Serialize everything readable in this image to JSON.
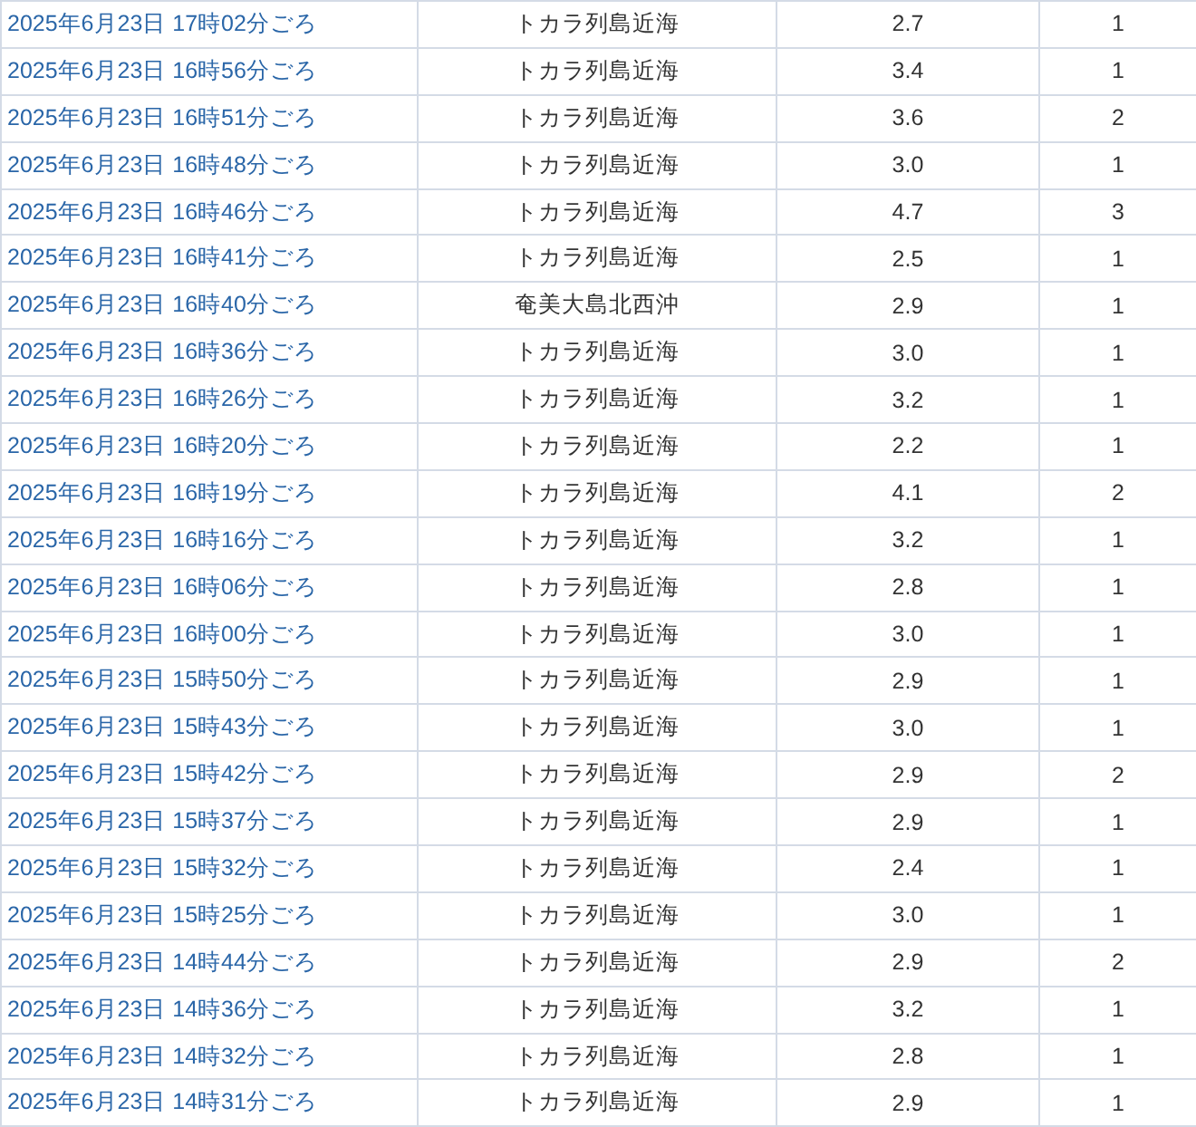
{
  "table": {
    "rows": [
      {
        "time": "2025年6月23日 17時02分ごろ",
        "region": "トカラ列島近海",
        "magnitude": "2.7",
        "intensity": "1"
      },
      {
        "time": "2025年6月23日 16時56分ごろ",
        "region": "トカラ列島近海",
        "magnitude": "3.4",
        "intensity": "1"
      },
      {
        "time": "2025年6月23日 16時51分ごろ",
        "region": "トカラ列島近海",
        "magnitude": "3.6",
        "intensity": "2"
      },
      {
        "time": "2025年6月23日 16時48分ごろ",
        "region": "トカラ列島近海",
        "magnitude": "3.0",
        "intensity": "1"
      },
      {
        "time": "2025年6月23日 16時46分ごろ",
        "region": "トカラ列島近海",
        "magnitude": "4.7",
        "intensity": "3"
      },
      {
        "time": "2025年6月23日 16時41分ごろ",
        "region": "トカラ列島近海",
        "magnitude": "2.5",
        "intensity": "1"
      },
      {
        "time": "2025年6月23日 16時40分ごろ",
        "region": "奄美大島北西沖",
        "magnitude": "2.9",
        "intensity": "1"
      },
      {
        "time": "2025年6月23日 16時36分ごろ",
        "region": "トカラ列島近海",
        "magnitude": "3.0",
        "intensity": "1"
      },
      {
        "time": "2025年6月23日 16時26分ごろ",
        "region": "トカラ列島近海",
        "magnitude": "3.2",
        "intensity": "1"
      },
      {
        "time": "2025年6月23日 16時20分ごろ",
        "region": "トカラ列島近海",
        "magnitude": "2.2",
        "intensity": "1"
      },
      {
        "time": "2025年6月23日 16時19分ごろ",
        "region": "トカラ列島近海",
        "magnitude": "4.1",
        "intensity": "2"
      },
      {
        "time": "2025年6月23日 16時16分ごろ",
        "region": "トカラ列島近海",
        "magnitude": "3.2",
        "intensity": "1"
      },
      {
        "time": "2025年6月23日 16時06分ごろ",
        "region": "トカラ列島近海",
        "magnitude": "2.8",
        "intensity": "1"
      },
      {
        "time": "2025年6月23日 16時00分ごろ",
        "region": "トカラ列島近海",
        "magnitude": "3.0",
        "intensity": "1"
      },
      {
        "time": "2025年6月23日 15時50分ごろ",
        "region": "トカラ列島近海",
        "magnitude": "2.9",
        "intensity": "1"
      },
      {
        "time": "2025年6月23日 15時43分ごろ",
        "region": "トカラ列島近海",
        "magnitude": "3.0",
        "intensity": "1"
      },
      {
        "time": "2025年6月23日 15時42分ごろ",
        "region": "トカラ列島近海",
        "magnitude": "2.9",
        "intensity": "2"
      },
      {
        "time": "2025年6月23日 15時37分ごろ",
        "region": "トカラ列島近海",
        "magnitude": "2.9",
        "intensity": "1"
      },
      {
        "time": "2025年6月23日 15時32分ごろ",
        "region": "トカラ列島近海",
        "magnitude": "2.4",
        "intensity": "1"
      },
      {
        "time": "2025年6月23日 15時25分ごろ",
        "region": "トカラ列島近海",
        "magnitude": "3.0",
        "intensity": "1"
      },
      {
        "time": "2025年6月23日 14時44分ごろ",
        "region": "トカラ列島近海",
        "magnitude": "2.9",
        "intensity": "2"
      },
      {
        "time": "2025年6月23日 14時36分ごろ",
        "region": "トカラ列島近海",
        "magnitude": "3.2",
        "intensity": "1"
      },
      {
        "time": "2025年6月23日 14時32分ごろ",
        "region": "トカラ列島近海",
        "magnitude": "2.8",
        "intensity": "1"
      },
      {
        "time": "2025年6月23日 14時31分ごろ",
        "region": "トカラ列島近海",
        "magnitude": "2.9",
        "intensity": "1"
      }
    ]
  }
}
